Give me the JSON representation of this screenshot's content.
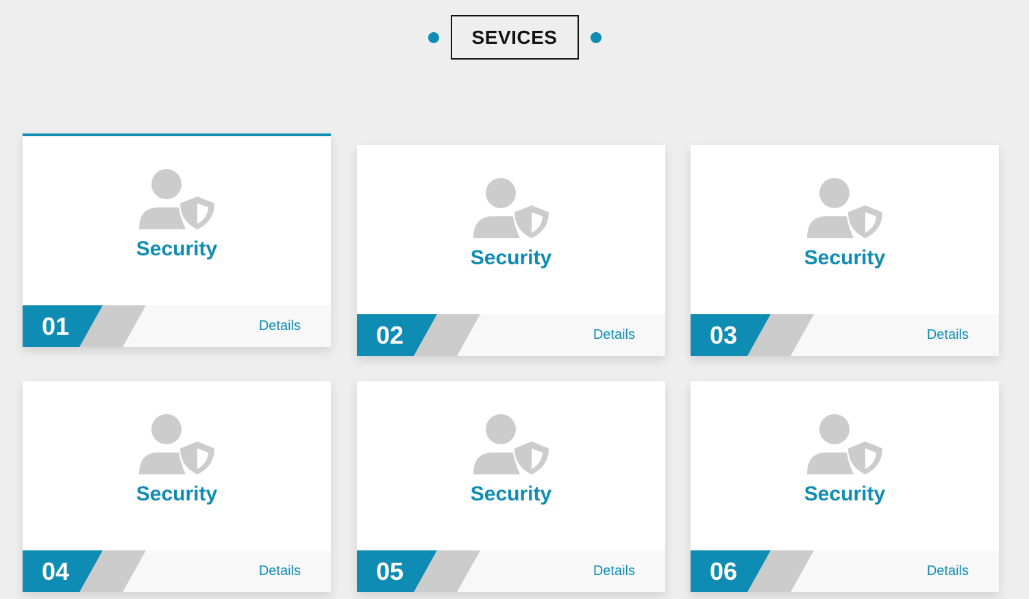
{
  "header": {
    "title": "SEVICES"
  },
  "colors": {
    "accent": "#0e8cb3",
    "icon_gray": "#cccccc",
    "background": "#eeeeee"
  },
  "cards": [
    {
      "number": "01",
      "title": "Security",
      "details_label": "Details",
      "icon": "user-shield-icon",
      "active": true
    },
    {
      "number": "02",
      "title": "Security",
      "details_label": "Details",
      "icon": "user-shield-icon",
      "active": false
    },
    {
      "number": "03",
      "title": "Security",
      "details_label": "Details",
      "icon": "user-shield-icon",
      "active": false
    },
    {
      "number": "04",
      "title": "Security",
      "details_label": "Details",
      "icon": "user-shield-icon",
      "active": false
    },
    {
      "number": "05",
      "title": "Security",
      "details_label": "Details",
      "icon": "user-shield-icon",
      "active": false
    },
    {
      "number": "06",
      "title": "Security",
      "details_label": "Details",
      "icon": "user-shield-icon",
      "active": false
    }
  ]
}
